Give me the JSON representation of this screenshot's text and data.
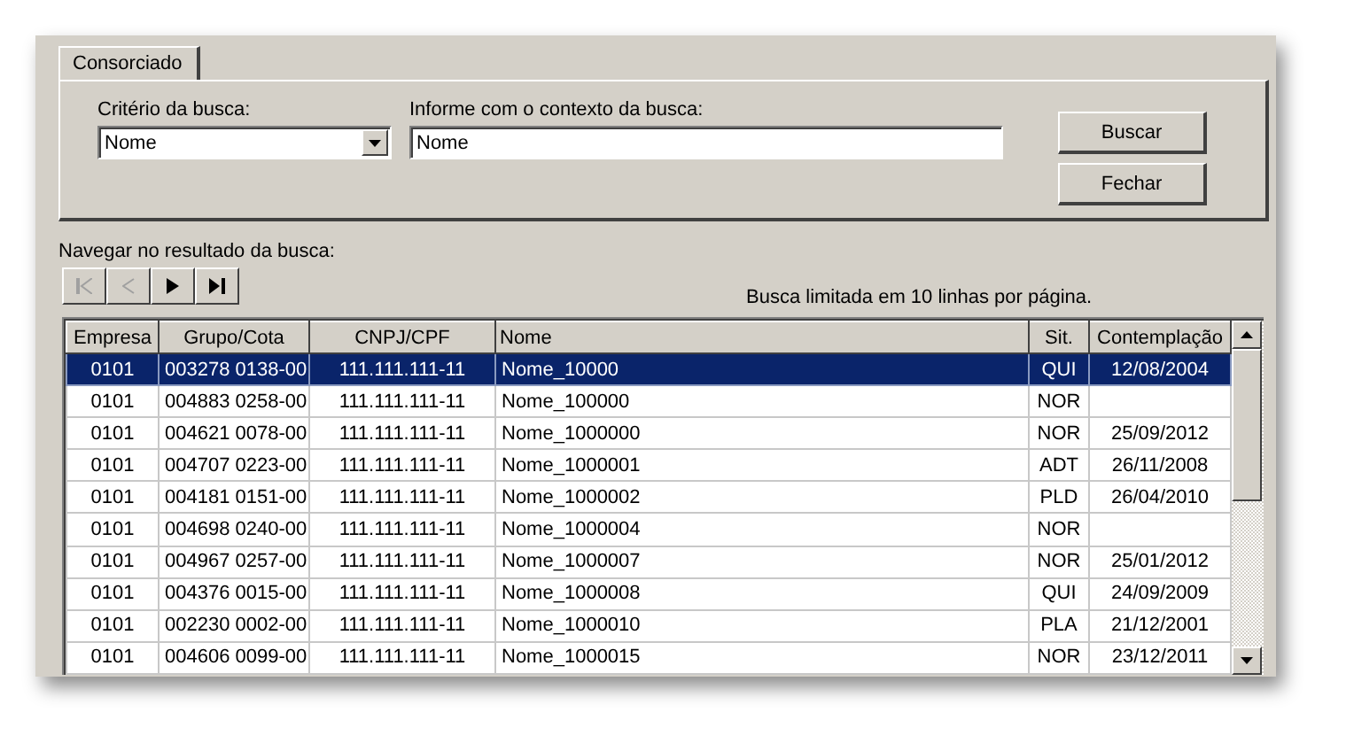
{
  "tabs": [
    {
      "label": "Consorciado",
      "selected": true
    }
  ],
  "criterion": {
    "label": "Critério da busca:",
    "value": "Nome"
  },
  "context": {
    "label": "Informe com o contexto da busca:",
    "value": "Nome"
  },
  "buttons": [
    {
      "label": "Buscar"
    },
    {
      "label": "Fechar"
    }
  ],
  "navigation": {
    "label": "Navegar no resultado da busca:",
    "buttons": [
      {
        "kind": "first",
        "disabled": true
      },
      {
        "kind": "prev",
        "disabled": true
      },
      {
        "kind": "next",
        "disabled": false
      },
      {
        "kind": "last",
        "disabled": false
      }
    ]
  },
  "limit_note": "Busca limitada em 10 linhas por página.",
  "table": {
    "columns": [
      "Empresa",
      "Grupo/Cota",
      "CNPJ/CPF",
      "Nome",
      "Sit.",
      "Contemplação"
    ],
    "rows": [
      {
        "selected": true,
        "cells": [
          "0101",
          "003278 0138-00",
          "111.111.111-11",
          "Nome_10000",
          "QUI",
          "12/08/2004"
        ]
      },
      {
        "selected": false,
        "cells": [
          "0101",
          "004883 0258-00",
          "111.111.111-11",
          "Nome_100000",
          "NOR",
          ""
        ]
      },
      {
        "selected": false,
        "cells": [
          "0101",
          "004621 0078-00",
          "111.111.111-11",
          "Nome_1000000",
          "NOR",
          "25/09/2012"
        ]
      },
      {
        "selected": false,
        "cells": [
          "0101",
          "004707 0223-00",
          "111.111.111-11",
          "Nome_1000001",
          "ADT",
          "26/11/2008"
        ]
      },
      {
        "selected": false,
        "cells": [
          "0101",
          "004181 0151-00",
          "111.111.111-11",
          "Nome_1000002",
          "PLD",
          "26/04/2010"
        ]
      },
      {
        "selected": false,
        "cells": [
          "0101",
          "004698 0240-00",
          "111.111.111-11",
          "Nome_1000004",
          "NOR",
          ""
        ]
      },
      {
        "selected": false,
        "cells": [
          "0101",
          "004967 0257-00",
          "111.111.111-11",
          "Nome_1000007",
          "NOR",
          "25/01/2012"
        ]
      },
      {
        "selected": false,
        "cells": [
          "0101",
          "004376 0015-00",
          "111.111.111-11",
          "Nome_1000008",
          "QUI",
          "24/09/2009"
        ]
      },
      {
        "selected": false,
        "cells": [
          "0101",
          "002230 0002-00",
          "111.111.111-11",
          "Nome_1000010",
          "PLA",
          "21/12/2001"
        ]
      },
      {
        "selected": false,
        "cells": [
          "0101",
          "004606 0099-00",
          "111.111.111-11",
          "Nome_1000015",
          "NOR",
          "23/12/2011"
        ]
      }
    ]
  }
}
